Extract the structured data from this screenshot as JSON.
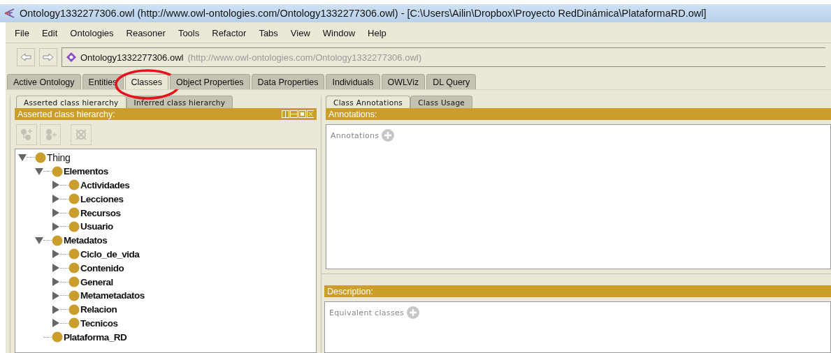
{
  "window": {
    "title": "Ontology1332277306.owl (http://www.owl-ontologies.com/Ontology1332277306.owl) - [C:\\Users\\Ailin\\Dropbox\\Proyecto RedDinámica\\PlataformaRD.owl]"
  },
  "menu": [
    "File",
    "Edit",
    "Ontologies",
    "Reasoner",
    "Tools",
    "Refactor",
    "Tabs",
    "View",
    "Window",
    "Help"
  ],
  "address": {
    "name": "Ontology1332277306.owl",
    "url": "(http://www.owl-ontologies.com/Ontology1332277306.owl)"
  },
  "tabs": [
    {
      "label": "Active Ontology",
      "selected": false
    },
    {
      "label": "Entities",
      "selected": false
    },
    {
      "label": "Classes",
      "selected": true,
      "circled": true
    },
    {
      "label": "Object Properties",
      "selected": false
    },
    {
      "label": "Data Properties",
      "selected": false
    },
    {
      "label": "Individuals",
      "selected": false
    },
    {
      "label": "OWLViz",
      "selected": false
    },
    {
      "label": "DL Query",
      "selected": false
    }
  ],
  "left_panel": {
    "tabs": [
      {
        "label": "Asserted class hierarchy",
        "selected": true
      },
      {
        "label": "Inferred class hierarchy",
        "selected": false
      }
    ],
    "header": "Asserted class hierarchy:",
    "tree": [
      {
        "label": "Thing",
        "expanded": true,
        "children": [
          {
            "label": "Elementos",
            "expanded": true,
            "children": [
              {
                "label": "Actividades",
                "expanded": false
              },
              {
                "label": "Lecciones",
                "expanded": false
              },
              {
                "label": "Recursos",
                "expanded": false
              },
              {
                "label": "Usuario",
                "expanded": false
              }
            ]
          },
          {
            "label": "Metadatos",
            "expanded": true,
            "children": [
              {
                "label": "Ciclo_de_vida",
                "expanded": false
              },
              {
                "label": "Contenido",
                "expanded": false
              },
              {
                "label": "General",
                "expanded": false
              },
              {
                "label": "Metametadatos",
                "expanded": false
              },
              {
                "label": "Relacion",
                "expanded": false
              },
              {
                "label": "Tecnicos",
                "expanded": false
              }
            ]
          },
          {
            "label": "Plataforma_RD"
          }
        ]
      }
    ]
  },
  "right_panel": {
    "tabs": [
      {
        "label": "Class Annotations",
        "selected": true
      },
      {
        "label": "Class Usage",
        "selected": false
      }
    ],
    "annotations_header": "Annotations:",
    "annotations_label": "Annotations",
    "description_header": "Description:",
    "equivalent_label": "Equivalent classes"
  }
}
